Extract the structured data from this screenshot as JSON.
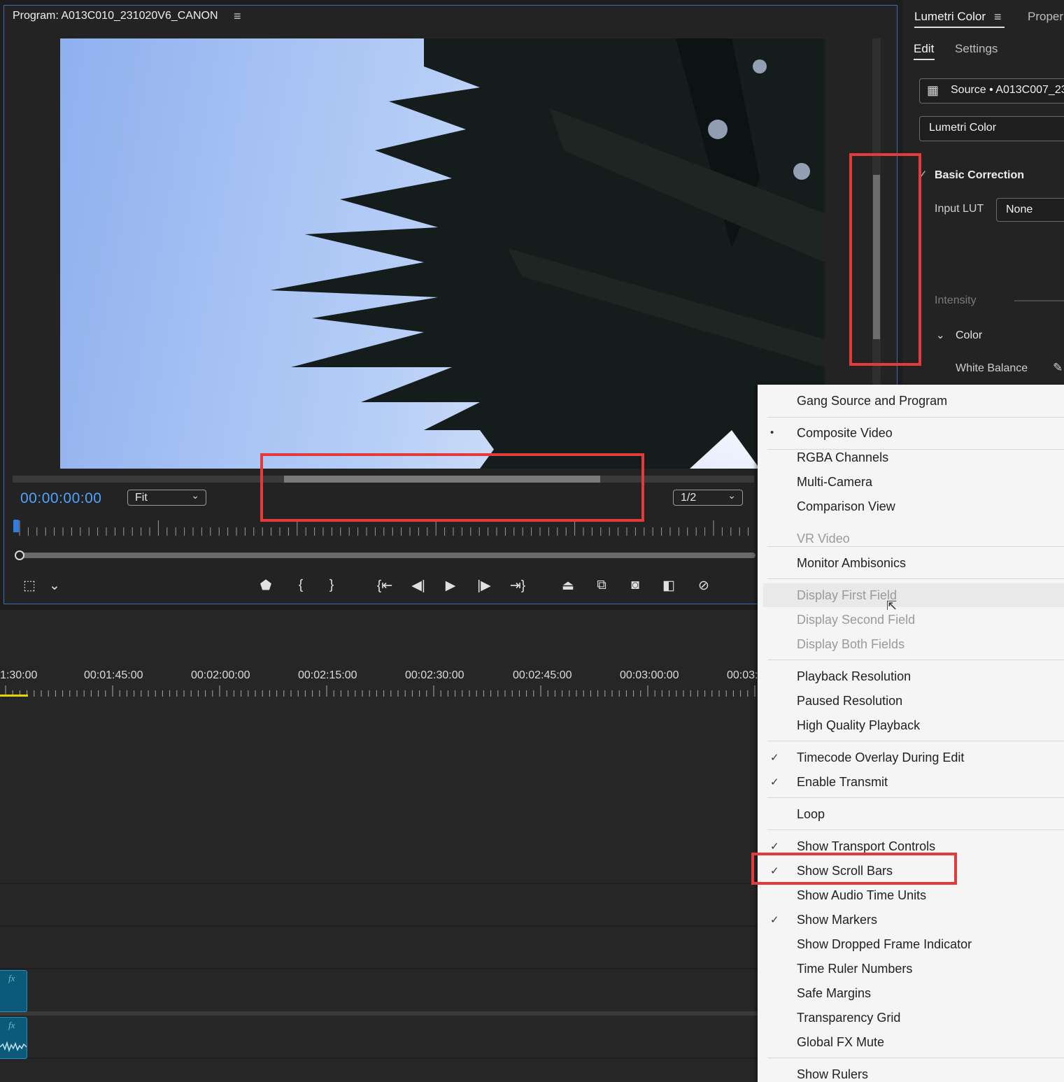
{
  "program": {
    "title": "Program: A013C010_231020V6_CANON",
    "menu_icon": "hamburger-icon",
    "timecode": "00:00:00:00",
    "zoom": "Fit",
    "resolution": "1/2"
  },
  "timeline": {
    "labels": [
      "1:30:00",
      "00:01:45:00",
      "00:02:00:00",
      "00:02:15:00",
      "00:02:30:00",
      "00:02:45:00",
      "00:03:00:00",
      "00:03:"
    ],
    "clip_fx": "fx"
  },
  "lumetri": {
    "tab": "Lumetri Color",
    "tab2": "Proper",
    "edit": "Edit",
    "settings": "Settings",
    "source": "Source • A013C007_23",
    "effect": "Lumetri Color",
    "basic_correction": "Basic Correction",
    "input_lut_label": "Input LUT",
    "input_lut_value": "None",
    "intensity": "Intensity",
    "color": "Color",
    "white_balance": "White Balance"
  },
  "menu": {
    "items": [
      {
        "label": "Gang Source and Program",
        "mark": "",
        "disabled": false
      },
      {
        "label": "Composite Video",
        "mark": "•",
        "disabled": false
      },
      {
        "label": "RGBA Channels",
        "mark": "",
        "disabled": false
      },
      {
        "label": "Multi-Camera",
        "mark": "",
        "disabled": false
      },
      {
        "label": "Comparison View",
        "mark": "",
        "disabled": false
      },
      {
        "label": "VR Video",
        "mark": "",
        "disabled": true
      },
      {
        "label": "Monitor Ambisonics",
        "mark": "",
        "disabled": false
      },
      {
        "label": "Display First Field",
        "mark": "",
        "disabled": true
      },
      {
        "label": "Display Second Field",
        "mark": "",
        "disabled": true
      },
      {
        "label": "Display Both Fields",
        "mark": "",
        "disabled": true
      },
      {
        "label": "Playback Resolution",
        "mark": "",
        "disabled": false
      },
      {
        "label": "Paused Resolution",
        "mark": "",
        "disabled": false
      },
      {
        "label": "High Quality Playback",
        "mark": "",
        "disabled": false
      },
      {
        "label": "Timecode Overlay During Edit",
        "mark": "✓",
        "disabled": false
      },
      {
        "label": "Enable Transmit",
        "mark": "✓",
        "disabled": false
      },
      {
        "label": "Loop",
        "mark": "",
        "disabled": false
      },
      {
        "label": "Show Transport Controls",
        "mark": "✓",
        "disabled": false
      },
      {
        "label": "Show Scroll Bars",
        "mark": "✓",
        "disabled": false
      },
      {
        "label": "Show Audio Time Units",
        "mark": "",
        "disabled": false
      },
      {
        "label": "Show Markers",
        "mark": "✓",
        "disabled": false
      },
      {
        "label": "Show Dropped Frame Indicator",
        "mark": "",
        "disabled": false
      },
      {
        "label": "Time Ruler Numbers",
        "mark": "",
        "disabled": false
      },
      {
        "label": "Safe Margins",
        "mark": "",
        "disabled": false
      },
      {
        "label": "Transparency Grid",
        "mark": "",
        "disabled": false
      },
      {
        "label": "Global FX Mute",
        "mark": "",
        "disabled": false
      },
      {
        "label": "Show Rulers",
        "mark": "",
        "disabled": false
      }
    ]
  },
  "colors": {
    "accent": "#4ea3ff",
    "highlight": "#e33b3b",
    "playhead": "#e8d400"
  }
}
